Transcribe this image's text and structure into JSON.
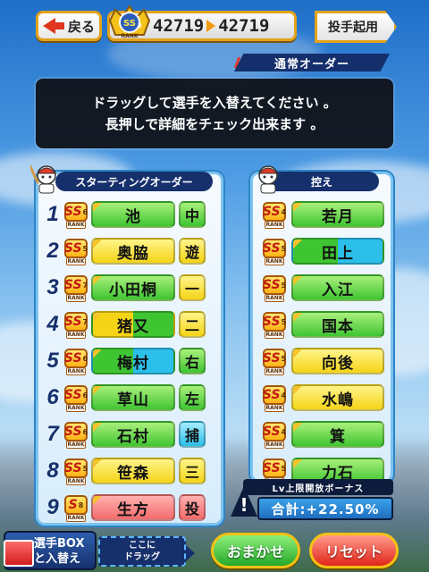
{
  "header": {
    "back_label": "戻る",
    "score_before": "42719",
    "score_after": "42719",
    "rank_badge": "SS",
    "rank_sub": "3",
    "rank_caption": "RANK",
    "pitcher_button": "投手起用"
  },
  "order_tab": "通常オーダー",
  "instructions": {
    "line1": "ドラッグして選手を入替えてください 。",
    "line2": "長押しで詳細をチェック出来ます 。"
  },
  "starting": {
    "title": "スターティングオーダー",
    "rows": [
      {
        "num": "1",
        "rank": "SS",
        "lvl": "6",
        "name": "池",
        "pos": "中",
        "color": "c-green",
        "poscolor": "c-green"
      },
      {
        "num": "2",
        "rank": "SS",
        "lvl": "5",
        "name": "奥脇",
        "pos": "遊",
        "color": "c-yellow",
        "poscolor": "c-yellow"
      },
      {
        "num": "3",
        "rank": "SS",
        "lvl": "7",
        "name": "小田桐",
        "pos": "一",
        "color": "c-green",
        "poscolor": "c-yellow"
      },
      {
        "num": "4",
        "rank": "SS",
        "lvl": "7",
        "name": "猪又",
        "pos": "二",
        "color": "c-yg",
        "poscolor": "c-yellow"
      },
      {
        "num": "5",
        "rank": "SS",
        "lvl": "6",
        "name": "梅村",
        "pos": "右",
        "color": "c-gb",
        "poscolor": "c-green"
      },
      {
        "num": "6",
        "rank": "SS",
        "lvl": "6",
        "name": "草山",
        "pos": "左",
        "color": "c-green",
        "poscolor": "c-green"
      },
      {
        "num": "7",
        "rank": "SS",
        "lvl": "6",
        "name": "石村",
        "pos": "捕",
        "color": "c-green",
        "poscolor": "c-blue"
      },
      {
        "num": "8",
        "rank": "SS",
        "lvl": "5",
        "name": "笹森",
        "pos": "三",
        "color": "c-yellow",
        "poscolor": "c-yellow"
      },
      {
        "num": "9",
        "rank": "S",
        "lvl": "8",
        "name": "生方",
        "pos": "投",
        "color": "c-red",
        "poscolor": "c-red"
      }
    ]
  },
  "bench": {
    "title": "控え",
    "rows": [
      {
        "rank": "SS",
        "lvl": "4",
        "name": "若月",
        "color": "c-green"
      },
      {
        "rank": "SS",
        "lvl": "5",
        "name": "田上",
        "color": "c-gb"
      },
      {
        "rank": "SS",
        "lvl": "5",
        "name": "入江",
        "color": "c-green"
      },
      {
        "rank": "SS",
        "lvl": "5",
        "name": "国本",
        "color": "c-green"
      },
      {
        "rank": "SS",
        "lvl": "5",
        "name": "向後",
        "color": "c-yellow"
      },
      {
        "rank": "SS",
        "lvl": "4",
        "name": "水嶋",
        "color": "c-yellow"
      },
      {
        "rank": "SS",
        "lvl": "4",
        "name": "箕",
        "color": "c-green"
      },
      {
        "rank": "SS",
        "lvl": "5",
        "name": "力石",
        "color": "c-green"
      }
    ]
  },
  "rank_caption": "RANK",
  "bonus": {
    "head": "Lv上限開放ボーナス",
    "value": "合計:+22.50%",
    "alert": "!"
  },
  "bottom": {
    "box_line1": "選手BOX",
    "box_line2": "と入替え",
    "drop_line1": "ここに",
    "drop_line2": "ドラッグ",
    "omakase": "おまかせ",
    "reset": "リセット"
  },
  "colors": {
    "navy": "#16306c",
    "gold": "#e3a21a",
    "green": "#3fc532",
    "yellow": "#f5d418",
    "blue": "#2cbfea",
    "red": "#f36a6a"
  }
}
